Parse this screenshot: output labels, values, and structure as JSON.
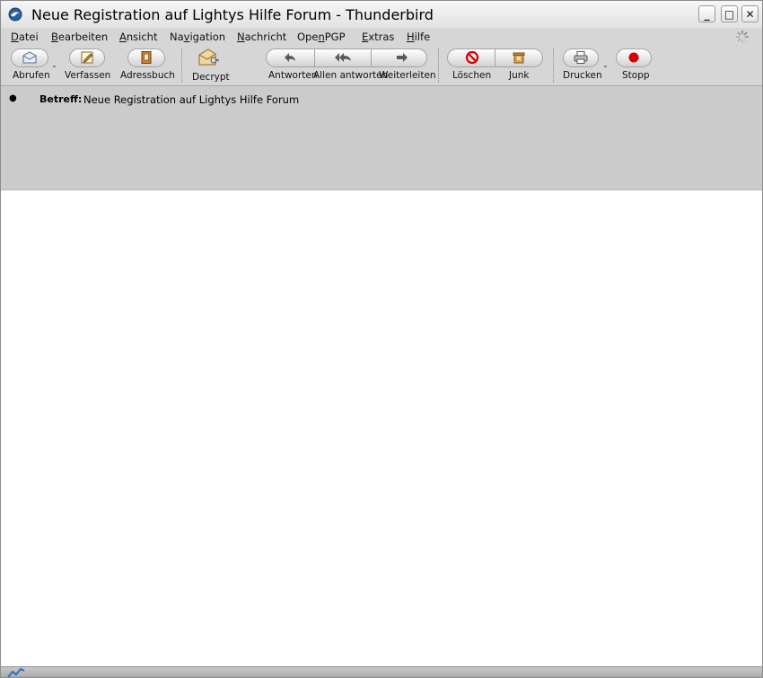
{
  "window": {
    "title": "Neue Registration auf Lightys Hilfe Forum - Thunderbird",
    "controls": {
      "minimize": "_",
      "maximize": "□",
      "close": "✕"
    }
  },
  "menu": [
    {
      "mnemonic": "D",
      "rest": "atei"
    },
    {
      "mnemonic": "B",
      "rest": "earbeiten"
    },
    {
      "mnemonic": "A",
      "rest": "nsicht"
    },
    {
      "pre": "Na",
      "mnemonic": "v",
      "rest": "igation"
    },
    {
      "mnemonic": "N",
      "rest": "achricht"
    },
    {
      "pre": "Ope",
      "mnemonic": "n",
      "rest": "PGP"
    },
    {
      "mnemonic": "E",
      "rest": "xtras"
    },
    {
      "mnemonic": "H",
      "rest": "ilfe"
    }
  ],
  "toolbar": {
    "get_mail": "Abrufen",
    "compose": "Verfassen",
    "address_book": "Adressbuch",
    "decrypt": "Decrypt",
    "reply": "Antworten",
    "reply_all": "Allen antworten",
    "forward": "Weiterleiten",
    "delete": "Löschen",
    "junk": "Junk",
    "print": "Drucken",
    "stop": "Stopp"
  },
  "header": {
    "subject_label": "Betreff:",
    "subject_value": "Neue Registration auf Lightys Hilfe Forum"
  },
  "colors": {
    "stop_red": "#d90000",
    "delete_red": "#d40000",
    "chrome_gray": "#d6d6d6",
    "header_gray": "#cbcbcb"
  }
}
